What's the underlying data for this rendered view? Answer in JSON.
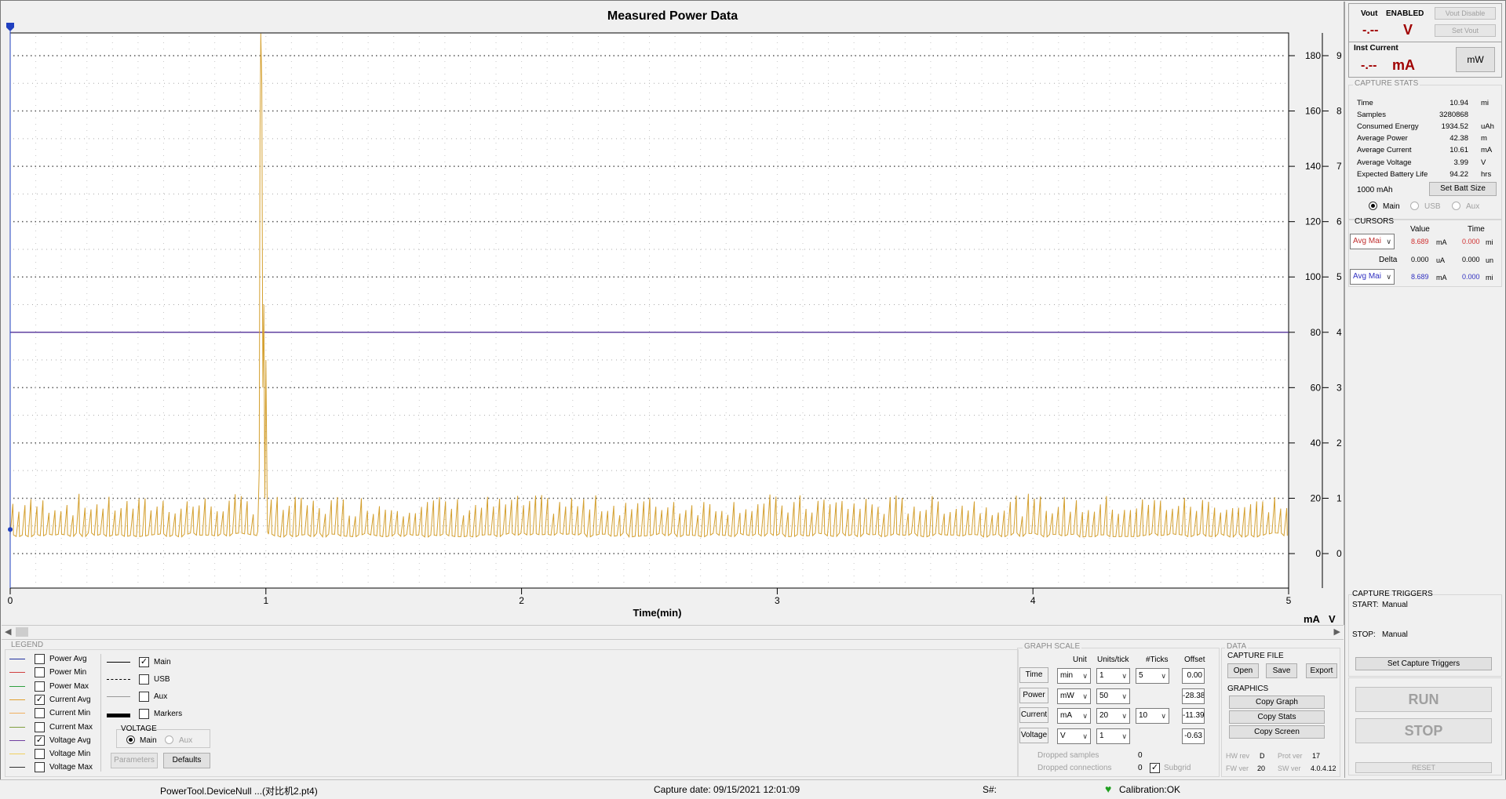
{
  "chart": {
    "title": "Measured Power Data",
    "xlabel": "Time(min)",
    "right_units": [
      "mA",
      "V"
    ],
    "x_ticks": [
      "0",
      "1",
      "2",
      "3",
      "4",
      "5"
    ],
    "y_ticks_current": [
      "180",
      "160",
      "140",
      "120",
      "100",
      "80",
      "60",
      "40",
      "20",
      "0"
    ],
    "y_ticks_voltage": [
      "9",
      "8",
      "7",
      "6",
      "5",
      "4",
      "3",
      "2",
      "1",
      "0"
    ]
  },
  "chart_data": {
    "type": "line",
    "title": "Measured Power Data",
    "xlabel": "Time(min)",
    "x_range": [
      0,
      5
    ],
    "y_axes": [
      {
        "unit": "mA",
        "range": [
          0,
          180
        ]
      },
      {
        "unit": "V",
        "range": [
          0,
          9
        ]
      }
    ],
    "series": [
      {
        "name": "Current Avg",
        "color": "#d4a030",
        "baseline_mA": 6,
        "periodic_peaks_mA": 12,
        "spike": {
          "x_min": 0.98,
          "peak_mA": 188
        }
      },
      {
        "name": "Voltage Avg",
        "color": "#6040a0",
        "constant_V": 4.0
      }
    ],
    "grid": true
  },
  "legend": {
    "title": "LEGEND",
    "items": [
      {
        "label": "Power Avg",
        "checked": false,
        "color": "#1f2f9f"
      },
      {
        "label": "Power Min",
        "checked": false,
        "color": "#d04040"
      },
      {
        "label": "Power Max",
        "checked": false,
        "color": "#30a040"
      },
      {
        "label": "Current Avg",
        "checked": true,
        "color": "#e0a030"
      },
      {
        "label": "Current Min",
        "checked": false,
        "color": "#f0b060"
      },
      {
        "label": "Current Max",
        "checked": false,
        "color": "#80a040"
      },
      {
        "label": "Voltage Avg",
        "checked": true,
        "color": "#7040a0"
      },
      {
        "label": "Voltage Min",
        "checked": false,
        "color": "#f0d060"
      },
      {
        "label": "Voltage Max",
        "checked": false,
        "color": "#303030"
      }
    ],
    "channels": [
      {
        "label": "Main",
        "checked": true
      },
      {
        "label": "USB",
        "checked": false
      },
      {
        "label": "Aux",
        "checked": false
      },
      {
        "label": "Markers",
        "checked": false
      }
    ],
    "voltage_title": "VOLTAGE",
    "voltage_main": "Main",
    "voltage_aux": "Aux",
    "parameters_btn": "Parameters",
    "defaults_btn": "Defaults"
  },
  "graph_scale": {
    "title": "GRAPH SCALE",
    "headers": {
      "unit": "Unit",
      "units_tick": "Units/tick",
      "ticks": "#Ticks",
      "offset": "Offset"
    },
    "rows": [
      {
        "label": "Time",
        "unit": "min",
        "units_tick": "1",
        "ticks": "5",
        "offset": "0.00"
      },
      {
        "label": "Power",
        "unit": "mW",
        "units_tick": "50",
        "ticks": "",
        "offset": "-28.38"
      },
      {
        "label": "Current",
        "unit": "mA",
        "units_tick": "20",
        "ticks": "10",
        "offset": "-11.39"
      },
      {
        "label": "Voltage",
        "unit": "V",
        "units_tick": "1",
        "ticks": "",
        "offset": "-0.63"
      }
    ],
    "dropped_samples_label": "Dropped samples",
    "dropped_samples": "0",
    "dropped_connections_label": "Dropped connections",
    "dropped_connections": "0",
    "subgrid_label": "Subgrid"
  },
  "data_panel": {
    "title": "DATA",
    "capture_file": "CAPTURE FILE",
    "open": "Open",
    "save": "Save",
    "export": "Export",
    "graphics": "GRAPHICS",
    "copy_graph": "Copy Graph",
    "copy_stats": "Copy Stats",
    "copy_screen": "Copy Screen",
    "hw_rev_label": "HW rev",
    "hw_rev": "D",
    "prot_ver_label": "Prot ver",
    "prot_ver": "17",
    "fw_ver_label": "FW ver",
    "fw_ver": "20",
    "sw_ver_label": "SW ver",
    "sw_ver": "4.0.4.12"
  },
  "vout": {
    "label": "Vout",
    "status": "ENABLED",
    "value": "-.--",
    "unit": "V",
    "disable_btn": "Vout Disable",
    "set_btn": "Set Vout"
  },
  "inst": {
    "label": "Inst Current",
    "value": "-.--",
    "unit": "mA",
    "mw_btn": "mW"
  },
  "capture_stats": {
    "title": "CAPTURE STATS",
    "rows": [
      {
        "k": "Time",
        "v": "10.94",
        "u": "mi"
      },
      {
        "k": "Samples",
        "v": "3280868",
        "u": ""
      },
      {
        "k": "Consumed Energy",
        "v": "1934.52",
        "u": "uAh"
      },
      {
        "k": "Average Power",
        "v": "42.38",
        "u": "m"
      },
      {
        "k": "Average Current",
        "v": "10.61",
        "u": "mA"
      },
      {
        "k": "Average Voltage",
        "v": "3.99",
        "u": "V"
      },
      {
        "k": "Expected Battery Life",
        "v": "94.22",
        "u": "hrs"
      }
    ],
    "batt_value": "1000",
    "batt_unit": "mAh",
    "set_batt_btn": "Set Batt Size",
    "radio_main": "Main",
    "radio_usb": "USB",
    "radio_aux": "Aux"
  },
  "cursors": {
    "title": "CURSORS",
    "value_h": "Value",
    "time_h": "Time",
    "c1_sel": "Avg Mai",
    "c1_value": "8.689",
    "c1_unit": "mA",
    "c1_time": "0.000",
    "c1_tunit": "mi",
    "delta_label": "Delta",
    "delta_value": "0.000",
    "delta_unit": "uA",
    "delta_time": "0.000",
    "delta_tunit": "un",
    "c2_sel": "Avg Mai",
    "c2_value": "8.689",
    "c2_unit": "mA",
    "c2_time": "0.000",
    "c2_tunit": "mi"
  },
  "triggers": {
    "title": "CAPTURE TRIGGERS",
    "start_label": "START:",
    "start_value": "Manual",
    "stop_label": "STOP:",
    "stop_value": "Manual",
    "set_btn": "Set Capture Triggers",
    "run_btn": "RUN",
    "stop_btn": "STOP",
    "reset_btn": "RESET"
  },
  "status": {
    "device": "PowerTool.DeviceNull ...(对比机2.pt4)",
    "capture_date": "Capture date: 09/15/2021 12:01:09",
    "serial": "S#:",
    "calibration": "Calibration:OK"
  }
}
